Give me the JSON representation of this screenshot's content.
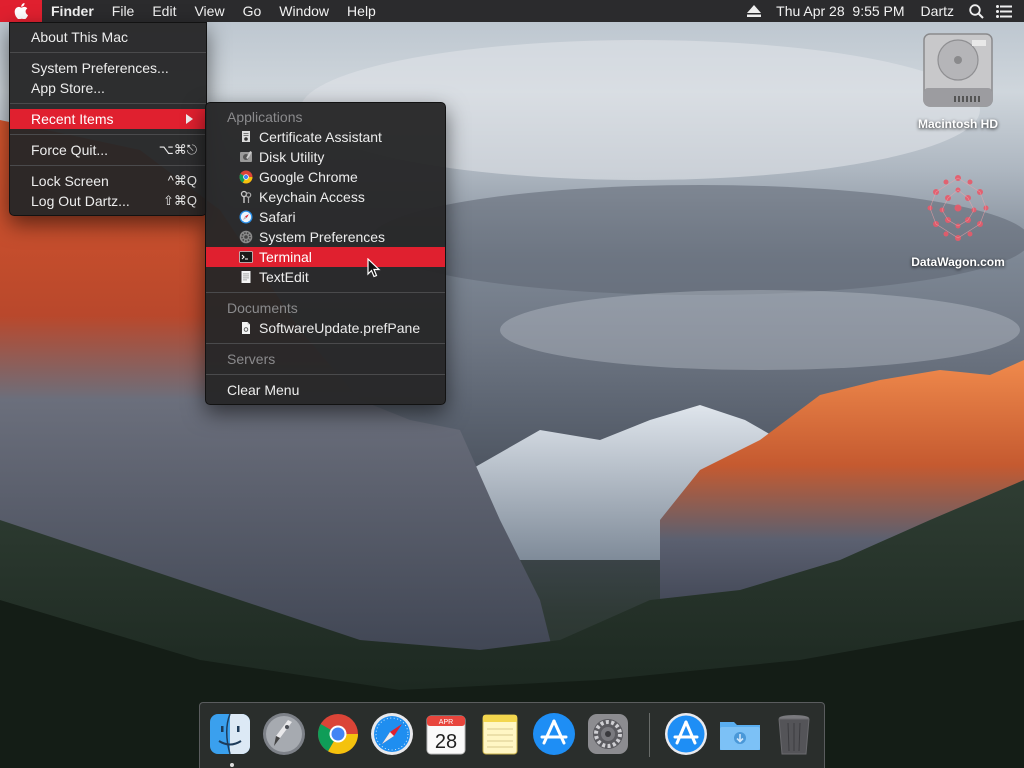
{
  "menubar": {
    "app_name": "Finder",
    "menus": [
      "File",
      "Edit",
      "View",
      "Go",
      "Window",
      "Help"
    ],
    "datetime": "Thu Apr 28  9:55 PM",
    "user": "Dartz"
  },
  "apple_menu": {
    "about": "About This Mac",
    "system_preferences": "System Preferences...",
    "app_store": "App Store...",
    "recent_items": "Recent Items",
    "force_quit": "Force Quit...",
    "force_quit_shortcut": "⌥⌘⎋",
    "lock_screen": "Lock Screen",
    "lock_screen_shortcut": "^⌘Q",
    "log_out": "Log Out Dartz...",
    "log_out_shortcut": "⇧⌘Q"
  },
  "recent_menu": {
    "applications_header": "Applications",
    "applications": [
      {
        "label": "Certificate Assistant",
        "icon": "certificate-icon"
      },
      {
        "label": "Disk Utility",
        "icon": "disk-utility-icon"
      },
      {
        "label": "Google Chrome",
        "icon": "chrome-icon"
      },
      {
        "label": "Keychain Access",
        "icon": "keychain-icon"
      },
      {
        "label": "Safari",
        "icon": "safari-icon"
      },
      {
        "label": "System Preferences",
        "icon": "gear-icon"
      },
      {
        "label": "Terminal",
        "icon": "terminal-icon"
      },
      {
        "label": "TextEdit",
        "icon": "textedit-icon"
      }
    ],
    "selected": "Terminal",
    "documents_header": "Documents",
    "documents": [
      {
        "label": "SoftwareUpdate.prefPane",
        "icon": "document-icon"
      }
    ],
    "servers_header": "Servers",
    "clear_menu": "Clear Menu"
  },
  "desktop": {
    "hd_label": "Macintosh HD",
    "datawagon_label": "DataWagon.com"
  },
  "dock": {
    "calendar_month": "APR",
    "calendar_day": "28",
    "items": [
      "finder-icon",
      "launchpad-icon",
      "chrome-icon",
      "safari-icon",
      "calendar-icon",
      "notes-icon",
      "app-store-icon",
      "system-preferences-icon",
      "app-store-downloads-icon",
      "downloads-folder-icon",
      "trash-icon"
    ]
  },
  "colors": {
    "accent": "#e0202f",
    "menubar": "#2b2b2d",
    "menu_bg": "#262628"
  }
}
